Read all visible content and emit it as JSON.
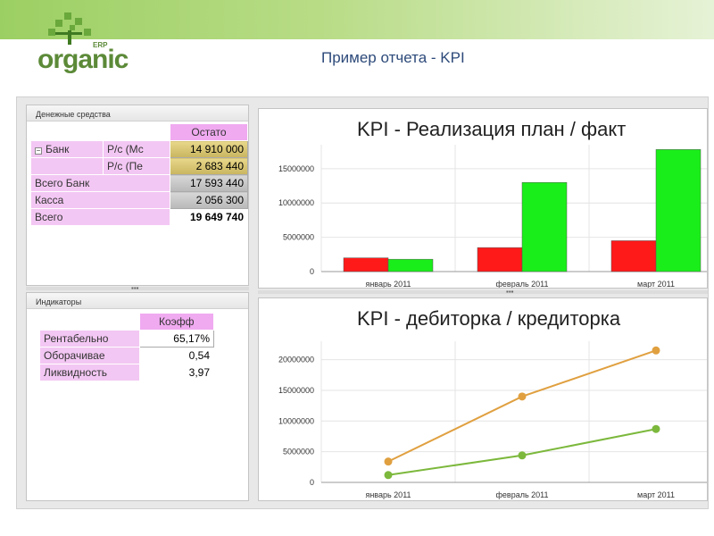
{
  "header": {
    "logo_text": "organic",
    "logo_suffix": "ERP",
    "title": "Пример отчета - KPI"
  },
  "cash_panel": {
    "title": "Денежные средства",
    "column_header": "Остато",
    "rows": [
      {
        "label": "Банк",
        "sub": "Р/с (Мс",
        "value": "14 910 000"
      },
      {
        "label": "",
        "sub": "Р/с (Пе",
        "value": "2 683 440"
      },
      {
        "label": "Всего Банк",
        "sub": "",
        "value": "17 593 440"
      },
      {
        "label": "Касса",
        "sub": "",
        "value": "2 056 300"
      },
      {
        "label": "Всего",
        "sub": "",
        "value": "19 649 740"
      }
    ]
  },
  "indicators_panel": {
    "title": "Индикаторы",
    "column_header": "Коэфф",
    "rows": [
      {
        "label": "Рентабельно",
        "value": "65,17%"
      },
      {
        "label": "Оборачивае",
        "value": "0,54"
      },
      {
        "label": "Ликвидность",
        "value": "3,97"
      }
    ]
  },
  "colors": {
    "plan_bar": "#ff1a1a",
    "fact_bar": "#1aee1a",
    "line_receivables": "#e0a040",
    "line_payables": "#7cb83c"
  },
  "chart_data": [
    {
      "type": "bar",
      "title": "KPI - Реализация план / факт",
      "categories": [
        "январь 2011",
        "февраль 2011",
        "март 2011"
      ],
      "series": [
        {
          "values": [
            2000000,
            3500000,
            4500000
          ]
        },
        {
          "values": [
            1800000,
            13000000,
            17800000
          ]
        }
      ],
      "y_ticks": [
        "0",
        "5000000",
        "10000000",
        "15000000"
      ],
      "ylim": [
        0,
        18500000
      ],
      "grid": true
    },
    {
      "type": "line",
      "title": "KPI - дебиторка / кредиторка",
      "categories": [
        "январь 2011",
        "февраль 2011",
        "март 2011"
      ],
      "series": [
        {
          "values": [
            3400000,
            14000000,
            21500000
          ]
        },
        {
          "values": [
            1200000,
            4400000,
            8700000
          ]
        }
      ],
      "y_ticks": [
        "0",
        "5000000",
        "10000000",
        "15000000",
        "20000000"
      ],
      "ylim": [
        0,
        23000000
      ],
      "grid": true
    }
  ]
}
